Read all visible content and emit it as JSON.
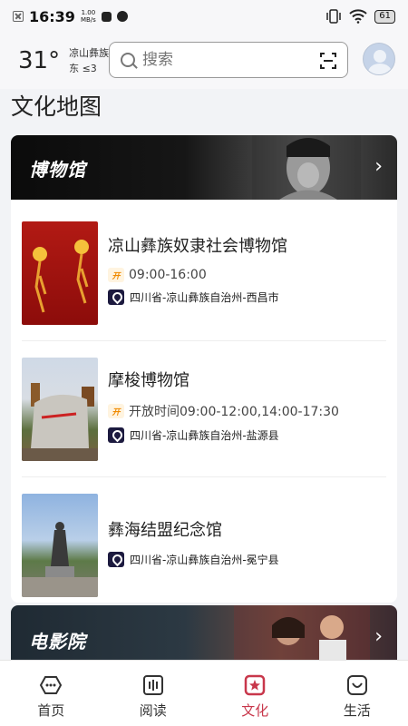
{
  "status_bar": {
    "time": "16:39",
    "speed_value": "1.00",
    "speed_unit": "MB/s",
    "battery": "61"
  },
  "header": {
    "temperature": "31°",
    "location": "凉山彝族自治州",
    "weather_detail": "东 ≤3",
    "search_placeholder": "搜索"
  },
  "page_title": "文化地图",
  "museum_section": {
    "title": "博物馆",
    "items": [
      {
        "name": "凉山彝族奴隶社会博物馆",
        "hours": "09:00-16:00",
        "address": "四川省-凉山彝族自治州-西昌市"
      },
      {
        "name": "摩梭博物馆",
        "hours": "开放时间09:00-12:00,14:00-17:30",
        "address": "四川省-凉山彝族自治州-盐源县"
      },
      {
        "name": "彝海结盟纪念馆",
        "address": "四川省-凉山彝族自治州-冕宁县"
      }
    ]
  },
  "cinema_section": {
    "title": "电影院"
  },
  "open_badge": "开",
  "nav": [
    {
      "label": "首页",
      "icon": "home-icon"
    },
    {
      "label": "阅读",
      "icon": "book-icon"
    },
    {
      "label": "文化",
      "icon": "culture-icon",
      "active": true
    },
    {
      "label": "生活",
      "icon": "life-icon"
    }
  ],
  "colors": {
    "accent": "#c8374b",
    "location_badge": "#1c1a3f",
    "open_badge": "#f08a00"
  }
}
